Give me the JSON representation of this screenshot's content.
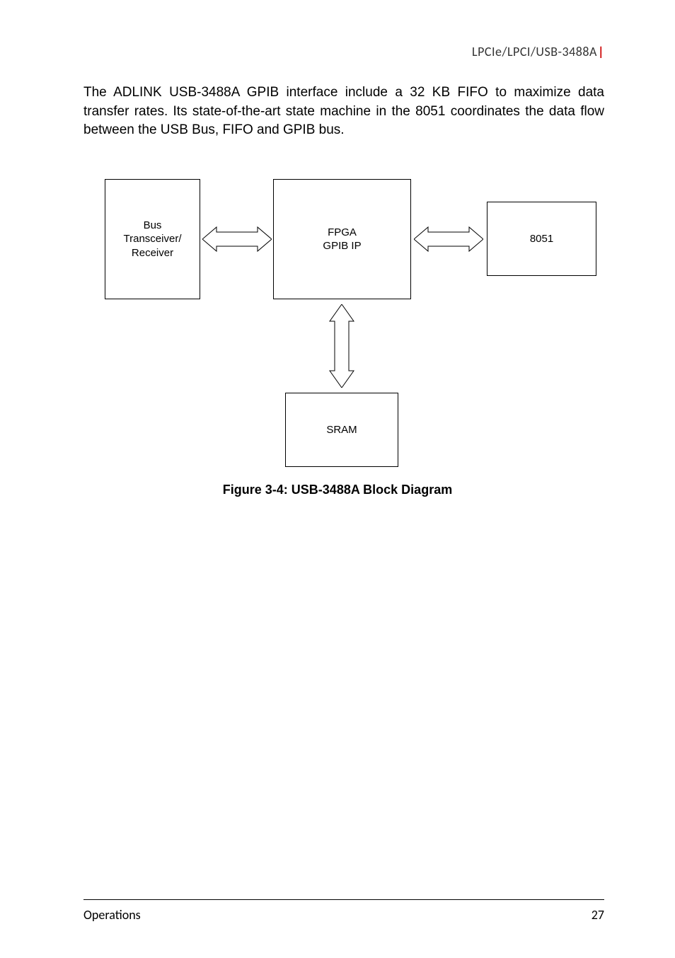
{
  "header": {
    "product_line": "LPCIe/LPCI/USB-3488A"
  },
  "body_paragraph": "The ADLINK USB-3488A GPIB interface include a 32 KB FIFO to maximize data transfer rates. Its state-of-the-art state machine in the 8051 coordinates the data flow between the USB Bus, FIFO and GPIB bus.",
  "diagram": {
    "blocks": {
      "transceiver": "Bus\nTransceiver/\nReceiver",
      "fpga": "FPGA\nGPIB IP",
      "mcu": "8051",
      "sram": "SRAM"
    }
  },
  "figure_caption": "Figure 3-4: USB-3488A Block Diagram",
  "footer": {
    "section": "Operations",
    "page": "27"
  }
}
